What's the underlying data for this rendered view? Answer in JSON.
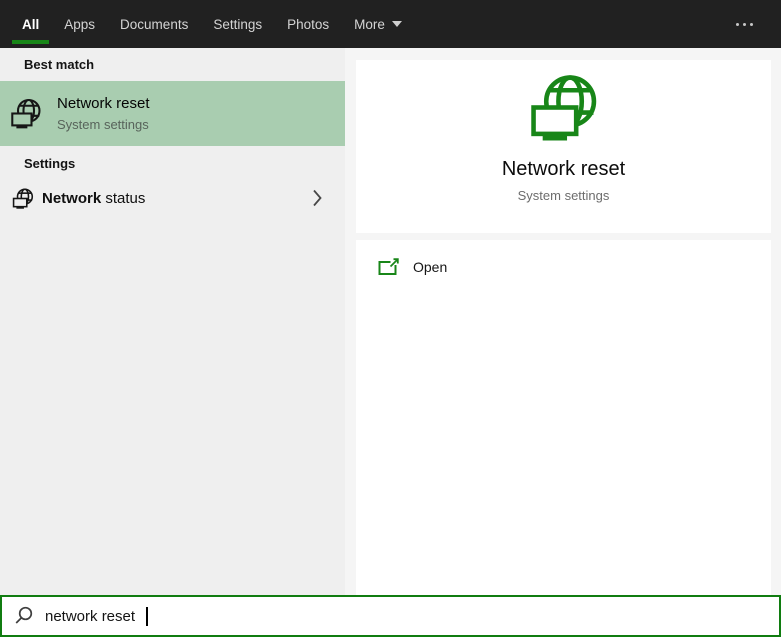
{
  "theme": {
    "topbar_bg": "#212121",
    "accent_green": "#107C10",
    "icon_green": "#188618",
    "highlight_green": "#a9cdb0",
    "left_panel_bg": "#efefef",
    "right_panel_bg": "#f5f5f5",
    "card_bg": "#ffffff",
    "tab_text": "#d4d4d4",
    "tab_active_text": "#ffffff",
    "muted_text": "#6d6d6d"
  },
  "topbar": {
    "tabs": [
      {
        "label": "All",
        "active": true
      },
      {
        "label": "Apps",
        "active": false
      },
      {
        "label": "Documents",
        "active": false
      },
      {
        "label": "Settings",
        "active": false
      },
      {
        "label": "Photos",
        "active": false
      }
    ],
    "more_label": "More",
    "more_icon": "chevron-down-icon",
    "overflow_icon": "ellipsis-icon"
  },
  "left_panel": {
    "best_match_header": "Best match",
    "best_match": {
      "title": "Network reset",
      "subtitle": "System settings",
      "icon": "network-reset-icon",
      "selected": true
    },
    "settings_header": "Settings",
    "settings_items": [
      {
        "match": "Network",
        "rest": " status",
        "icon": "network-icon",
        "chevron": "chevron-right-icon"
      }
    ]
  },
  "preview_panel": {
    "icon": "network-reset-icon",
    "title": "Network reset",
    "subtitle": "System settings",
    "actions": [
      {
        "label": "Open",
        "icon": "open-in-new-icon"
      }
    ]
  },
  "search_bar": {
    "icon": "search-icon",
    "value": "network reset",
    "placeholder": ""
  }
}
